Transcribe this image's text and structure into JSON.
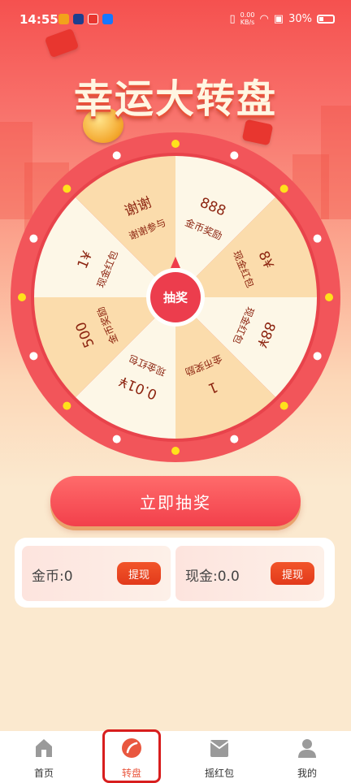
{
  "status_bar": {
    "time": "14:55",
    "net_speed_value": "0.00",
    "net_speed_unit": "KB/s",
    "battery": "30%"
  },
  "page_title": "幸运大转盘",
  "wheel": {
    "center_label": "抽奖",
    "segments": [
      {
        "value": "888",
        "caption": "金币奖励"
      },
      {
        "value": "8¥",
        "caption": "现金红包"
      },
      {
        "value": "88¥",
        "caption": "现金红包"
      },
      {
        "value": "1",
        "caption": "金币奖励"
      },
      {
        "value": "0.01¥",
        "caption": "现金红包"
      },
      {
        "value": "500",
        "caption": "金币奖励"
      },
      {
        "value": "1¥",
        "caption": "现金红包"
      },
      {
        "value": "谢谢",
        "caption": "谢谢参与"
      }
    ],
    "colors": {
      "rim": "#f2555a",
      "segment_light": "#fdf7e7",
      "segment_dark": "#fbdcac",
      "bulb_white": "#ffffff",
      "bulb_yellow": "#ffe11b"
    }
  },
  "draw_button": "立即抽奖",
  "balances": {
    "coins_label": "金币:0",
    "cash_label": "现金:0.0",
    "withdraw_label": "提现"
  },
  "tabs": [
    {
      "label": "首页",
      "icon": "home-icon"
    },
    {
      "label": "转盘",
      "icon": "wheel-icon"
    },
    {
      "label": "摇红包",
      "icon": "red-envelope-icon"
    },
    {
      "label": "我的",
      "icon": "user-icon"
    }
  ],
  "active_tab": "转盘",
  "accent": "#e9573f"
}
